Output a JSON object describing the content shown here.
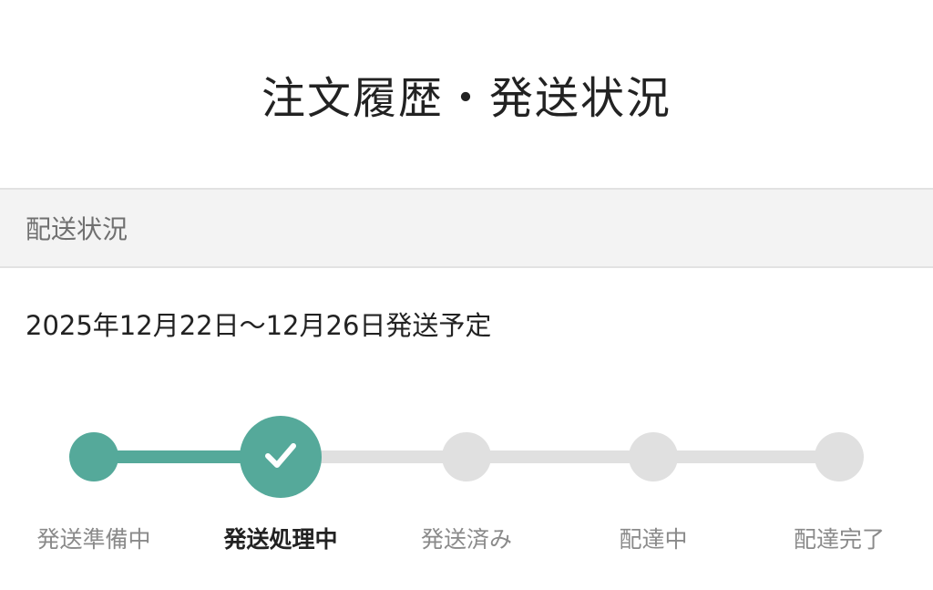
{
  "header": {
    "title": "注文履歴・発送状況"
  },
  "section": {
    "label": "配送状況"
  },
  "shipping": {
    "schedule": "2025年12月22日〜12月26日発送予定"
  },
  "progress": {
    "current_step_index": 1,
    "steps": [
      {
        "label": "発送準備中",
        "state": "done"
      },
      {
        "label": "発送処理中",
        "state": "current"
      },
      {
        "label": "発送済み",
        "state": "todo"
      },
      {
        "label": "配達中",
        "state": "todo"
      },
      {
        "label": "配達完了",
        "state": "todo"
      }
    ]
  },
  "colors": {
    "accent": "#55a99a",
    "inactive": "#e0e0e0",
    "label_inactive": "#8a8a8a",
    "label_active": "#222222"
  },
  "icons": {
    "current_step": "check-icon"
  }
}
